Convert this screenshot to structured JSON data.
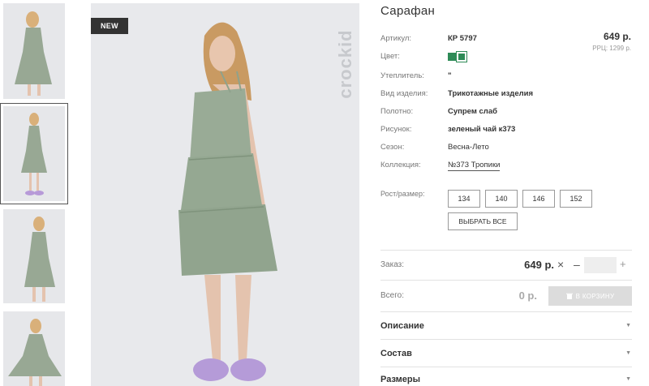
{
  "badge": "NEW",
  "brand": "crockid",
  "product": {
    "title": "Сарафан",
    "price": "649 р.",
    "rrp": "РРЦ: 1299 р.",
    "specs": [
      {
        "label": "Артикул:",
        "value": "КР 5797"
      },
      {
        "label": "Цвет:",
        "value": ""
      },
      {
        "label": "Утеплитель:",
        "value": "\""
      },
      {
        "label": "Вид изделия:",
        "value": "Трикотажные изделия"
      },
      {
        "label": "Полотно:",
        "value": "Супрем слаб"
      },
      {
        "label": "Рисунок:",
        "value": "зеленый чай к373"
      },
      {
        "label": "Сезон:",
        "value": "Весна-Лето"
      },
      {
        "label": "Коллекция:",
        "value": "№373 Тропики"
      }
    ],
    "color_swatch": "#2e8b57"
  },
  "sizes": {
    "label": "Рост/размер:",
    "options": [
      "134",
      "140",
      "146",
      "152"
    ],
    "select_all": "ВЫБРАТЬ ВСЕ"
  },
  "order": {
    "label": "Заказ:",
    "price": "649 р.",
    "times": "×",
    "minus": "–",
    "plus": "+",
    "qty": ""
  },
  "total": {
    "label": "Всего:",
    "value": "0 р.",
    "cart_button": "В КОРЗИНУ"
  },
  "accordion": [
    "Описание",
    "Состав",
    "Размеры"
  ]
}
